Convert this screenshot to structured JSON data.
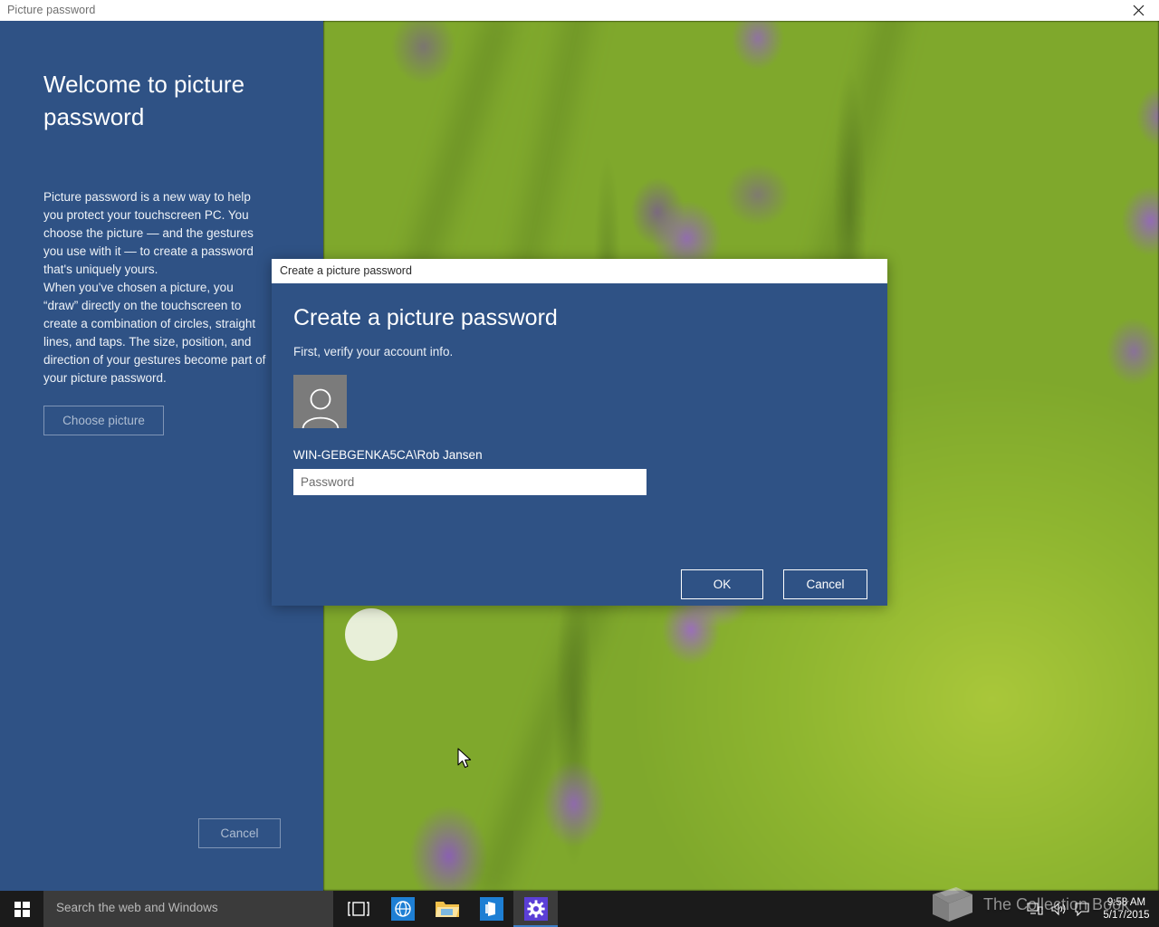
{
  "window": {
    "title": "Picture password",
    "close_icon": "close-icon"
  },
  "left_panel": {
    "heading": "Welcome to picture password",
    "paragraph1": "Picture password is a new way to help you protect your touchscreen PC. You choose the picture — and the gestures you use with it — to create a password that's uniquely yours.",
    "paragraph2": "When you've chosen a picture, you “draw” directly on the touchscreen to create a combination of circles, straight lines, and taps. The size, position, and direction of your gestures become part of your picture password.",
    "choose_picture_label": "Choose picture",
    "cancel_label": "Cancel",
    "background_color": "#2f5285"
  },
  "dialog": {
    "titlebar": "Create a picture password",
    "heading": "Create a picture password",
    "subtitle": "First, verify your account info.",
    "avatar_icon": "user-avatar-icon",
    "account_name": "WIN-GEBGENKA5CA\\Rob Jansen",
    "password_value": "",
    "password_placeholder": "Password",
    "ok_label": "OK",
    "cancel_label": "Cancel",
    "background_color": "#2f5285"
  },
  "taskbar": {
    "start_icon": "windows-start-icon",
    "search_placeholder": "Search the web and Windows",
    "items": [
      {
        "name": "task-view-icon",
        "label": "Task View"
      },
      {
        "name": "edge-browser-icon",
        "label": "Microsoft Edge"
      },
      {
        "name": "file-explorer-icon",
        "label": "File Explorer"
      },
      {
        "name": "store-icon",
        "label": "Store"
      },
      {
        "name": "settings-gear-icon",
        "label": "Settings",
        "active": true
      }
    ],
    "tray": [
      {
        "name": "network-icon"
      },
      {
        "name": "volume-icon"
      },
      {
        "name": "action-center-icon"
      }
    ],
    "clock_time": "9:58 AM",
    "clock_date": "5/17/2015"
  },
  "watermark": {
    "text": "The Collection Book",
    "icon": "book-icon"
  }
}
